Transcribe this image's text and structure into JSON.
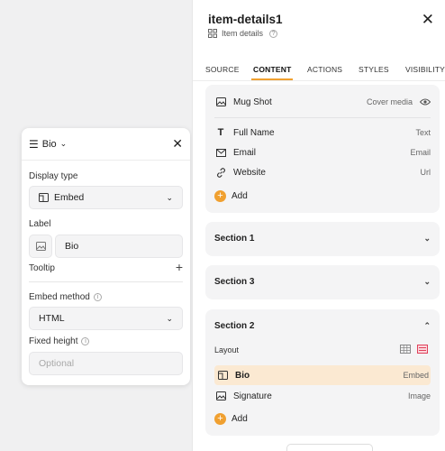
{
  "left_panel": {
    "title": "Bio",
    "display_type_label": "Display type",
    "display_type_value": "Embed",
    "label_label": "Label",
    "label_value": "Bio",
    "tooltip_label": "Tooltip",
    "embed_method_label": "Embed method",
    "embed_method_value": "HTML",
    "fixed_height_label": "Fixed height",
    "fixed_height_placeholder": "Optional"
  },
  "right_panel": {
    "title": "item-details1",
    "subtitle": "Item details",
    "tabs": [
      "SOURCE",
      "CONTENT",
      "ACTIONS",
      "STYLES",
      "VISIBILITY"
    ],
    "active_tab": "CONTENT",
    "top_card": {
      "media_row": {
        "label": "Mug Shot",
        "type": "Cover media"
      },
      "fields": [
        {
          "label": "Full Name",
          "type": "Text",
          "icon": "text-icon"
        },
        {
          "label": "Email",
          "type": "Email",
          "icon": "email-icon"
        },
        {
          "label": "Website",
          "type": "Url",
          "icon": "link-icon"
        }
      ],
      "add_label": "Add"
    },
    "sections": [
      {
        "title": "Section 1"
      },
      {
        "title": "Section 3"
      }
    ],
    "section2": {
      "title": "Section 2",
      "layout_label": "Layout",
      "fields": [
        {
          "label": "Bio",
          "type": "Embed",
          "icon": "embed-icon"
        },
        {
          "label": "Signature",
          "type": "Image",
          "icon": "image-icon"
        }
      ],
      "add_label": "Add"
    }
  },
  "colors": {
    "accent": "#f0a030",
    "selected_row": "#fbe9d2",
    "card_bg": "#f4f4f5",
    "layout_active": "#e0405a"
  }
}
